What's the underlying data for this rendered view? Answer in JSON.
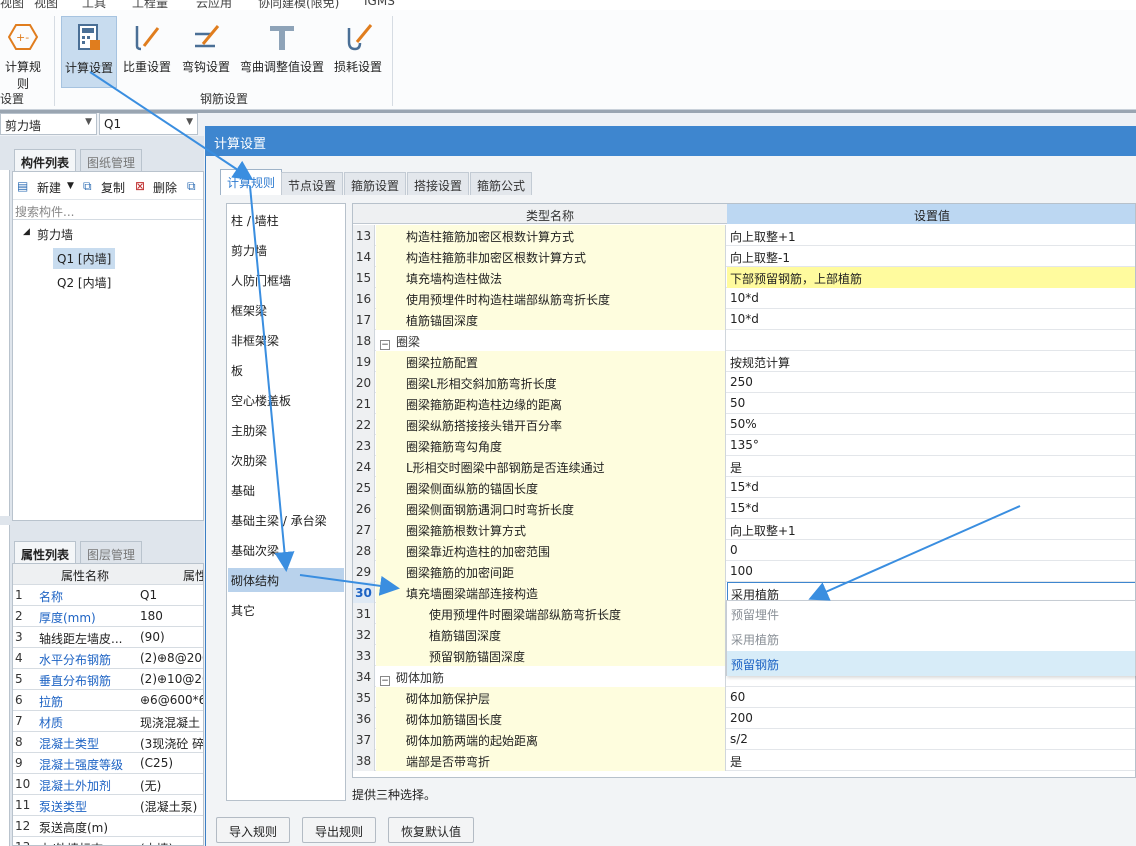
{
  "menu": [
    "视图",
    "工具",
    "工程量",
    "云应用",
    "协同建模(限免)",
    "IGMS"
  ],
  "ribbon": {
    "left_partial_label": "计算规则",
    "left_group_partial": "设置",
    "buttons": [
      "计算设置",
      "比重设置",
      "弯钩设置",
      "弯曲调整值设置",
      "损耗设置"
    ],
    "group_label": "钢筋设置"
  },
  "left": {
    "combo_type": "剪力墙",
    "combo_name": "Q1",
    "component_tab": "构件列表",
    "drawing_tab": "图纸管理",
    "new_label": "新建",
    "copy_label": "复制",
    "delete_label": "删除",
    "search_placeholder": "搜索构件...",
    "tree_root": "剪力墙",
    "tree_items": [
      "Q1 [内墙]",
      "Q2 [内墙]"
    ],
    "prop_tab": "属性列表",
    "layer_tab": "图层管理",
    "prop_header_name": "属性名称",
    "prop_header_value": "属性",
    "props": [
      {
        "n": "1",
        "k": "名称",
        "v": "Q1",
        "blue": true
      },
      {
        "n": "2",
        "k": "厚度(mm)",
        "v": "180",
        "blue": true
      },
      {
        "n": "3",
        "k": "轴线距左墙皮...",
        "v": "(90)",
        "blue": false
      },
      {
        "n": "4",
        "k": "水平分布钢筋",
        "v": "(2)⊕8@200",
        "blue": true
      },
      {
        "n": "5",
        "k": "垂直分布钢筋",
        "v": "(2)⊕10@20",
        "blue": true
      },
      {
        "n": "6",
        "k": "拉筋",
        "v": "⊕6@600*6",
        "blue": true
      },
      {
        "n": "7",
        "k": "材质",
        "v": "现浇混凝土",
        "blue": true
      },
      {
        "n": "8",
        "k": "混凝土类型",
        "v": "(3现浇砼 碎",
        "blue": true
      },
      {
        "n": "9",
        "k": "混凝土强度等级",
        "v": "(C25)",
        "blue": true
      },
      {
        "n": "10",
        "k": "混凝土外加剂",
        "v": "(无)",
        "blue": true
      },
      {
        "n": "11",
        "k": "泵送类型",
        "v": "(混凝土泵)",
        "blue": true
      },
      {
        "n": "12",
        "k": "泵送高度(m)",
        "v": "",
        "blue": false
      },
      {
        "n": "13",
        "k": "内/外墙标志",
        "v": "(内墙)",
        "blue": false
      }
    ]
  },
  "dialog": {
    "title": "计算设置",
    "tabs": [
      "计算规则",
      "节点设置",
      "箍筋设置",
      "搭接设置",
      "箍筋公式"
    ],
    "categories": [
      "柱 / 墙柱",
      "剪力墙",
      "人防门框墙",
      "框架梁",
      "非框架梁",
      "板",
      "空心楼盖板",
      "主肋梁",
      "次肋梁",
      "基础",
      "基础主梁 / 承台梁",
      "基础次梁",
      "砌体结构",
      "其它"
    ],
    "selected_category": "砌体结构",
    "col_name": "类型名称",
    "col_value": "设置值",
    "rows": [
      {
        "n": "13",
        "k": "构造柱箍筋加密区根数计算方式",
        "v": "向上取整+1"
      },
      {
        "n": "14",
        "k": "构造柱箍筋非加密区根数计算方式",
        "v": "向上取整-1"
      },
      {
        "n": "15",
        "k": "填充墙构造柱做法",
        "v": "下部预留钢筋，上部植筋"
      },
      {
        "n": "16",
        "k": "使用预埋件时构造柱端部纵筋弯折长度",
        "v": "10*d"
      },
      {
        "n": "17",
        "k": "植筋锚固深度",
        "v": "10*d"
      },
      {
        "n": "18",
        "k": "圈梁",
        "v": ""
      },
      {
        "n": "19",
        "k": "圈梁拉筋配置",
        "v": "按规范计算"
      },
      {
        "n": "20",
        "k": "圈梁L形相交斜加筋弯折长度",
        "v": "250"
      },
      {
        "n": "21",
        "k": "圈梁箍筋距构造柱边缘的距离",
        "v": "50"
      },
      {
        "n": "22",
        "k": "圈梁纵筋搭接接头错开百分率",
        "v": "50%"
      },
      {
        "n": "23",
        "k": "圈梁箍筋弯勾角度",
        "v": "135°"
      },
      {
        "n": "24",
        "k": "L形相交时圈梁中部钢筋是否连续通过",
        "v": "是"
      },
      {
        "n": "25",
        "k": "圈梁侧面纵筋的锚固长度",
        "v": "15*d"
      },
      {
        "n": "26",
        "k": "圈梁侧面钢筋遇洞口时弯折长度",
        "v": "15*d"
      },
      {
        "n": "27",
        "k": "圈梁箍筋根数计算方式",
        "v": "向上取整+1"
      },
      {
        "n": "28",
        "k": "圈梁靠近构造柱的加密范围",
        "v": "0"
      },
      {
        "n": "29",
        "k": "圈梁箍筋的加密间距",
        "v": "100"
      },
      {
        "n": "30",
        "k": "填充墙圈梁端部连接构造",
        "v": "采用植筋"
      },
      {
        "n": "31",
        "k": "使用预埋件时圈梁端部纵筋弯折长度",
        "v": ""
      },
      {
        "n": "32",
        "k": "植筋锚固深度",
        "v": ""
      },
      {
        "n": "33",
        "k": "预留钢筋锚固深度",
        "v": ""
      },
      {
        "n": "34",
        "k": "砌体加筋",
        "v": ""
      },
      {
        "n": "35",
        "k": "砌体加筋保护层",
        "v": "60"
      },
      {
        "n": "36",
        "k": "砌体加筋锚固长度",
        "v": "200"
      },
      {
        "n": "37",
        "k": "砌体加筋两端的起始距离",
        "v": "s/2"
      },
      {
        "n": "38",
        "k": "端部是否带弯折",
        "v": "是"
      }
    ],
    "dropdown_options": [
      "预留埋件",
      "采用植筋",
      "预留钢筋"
    ],
    "hint": "提供三种选择。",
    "btn_import": "导入规则",
    "btn_export": "导出规则",
    "btn_restore": "恢复默认值"
  },
  "colors": {
    "accent": "#3e86cf",
    "arrow": "#3a8ee0",
    "highlight": "#fffb9e",
    "name_cell": "#fefdde"
  }
}
